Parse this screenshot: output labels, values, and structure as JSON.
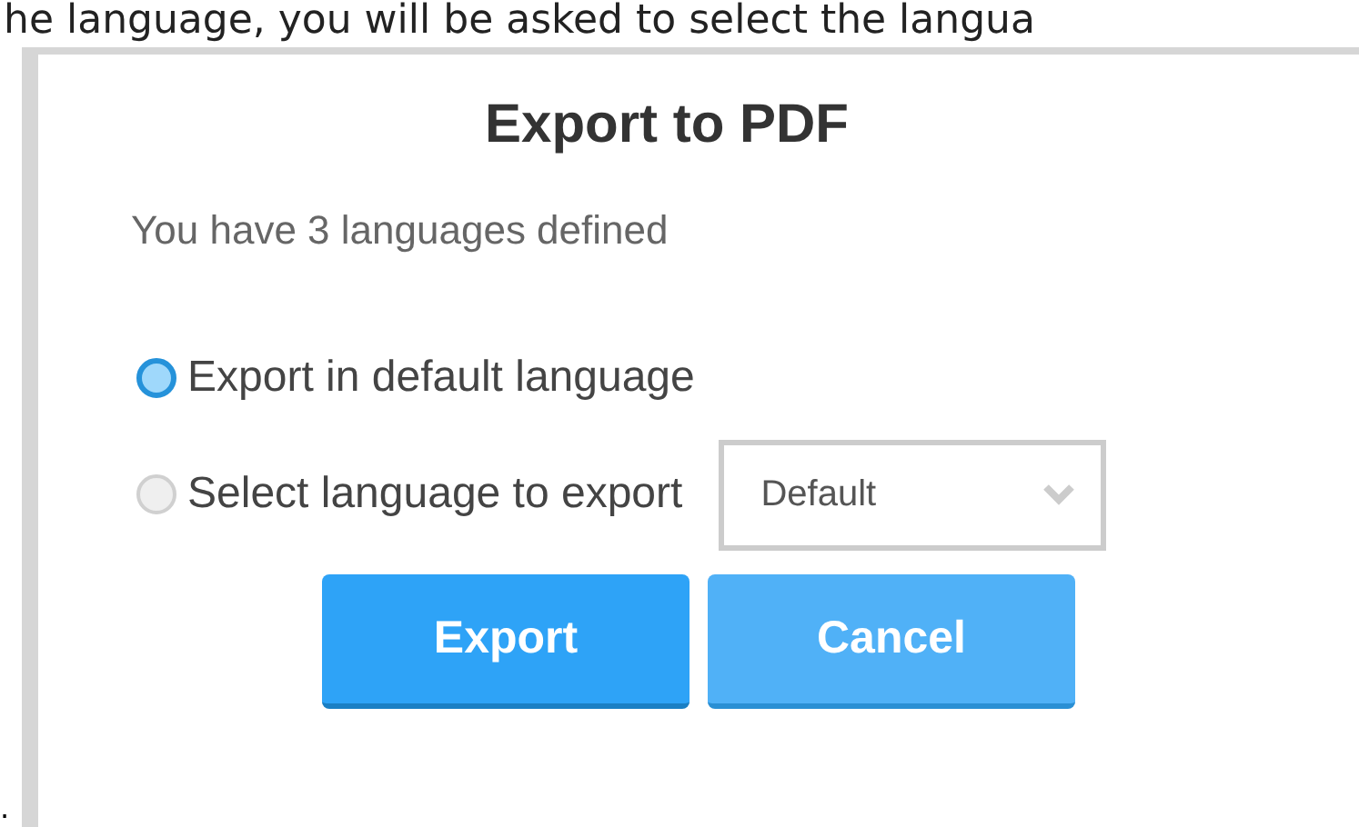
{
  "caption_text": "he language, you will be asked to select the langua",
  "dialog": {
    "title": "Export to PDF",
    "subtitle": "You have 3 languages defined",
    "options": [
      {
        "label": "Export in default language",
        "selected": true
      },
      {
        "label": "Select language to export",
        "selected": false,
        "dropdown": {
          "value": "Default"
        }
      }
    ],
    "buttons": [
      {
        "label": "Export",
        "kind": "primary"
      },
      {
        "label": "Cancel",
        "kind": "secondary"
      }
    ]
  },
  "trailing_text": "."
}
